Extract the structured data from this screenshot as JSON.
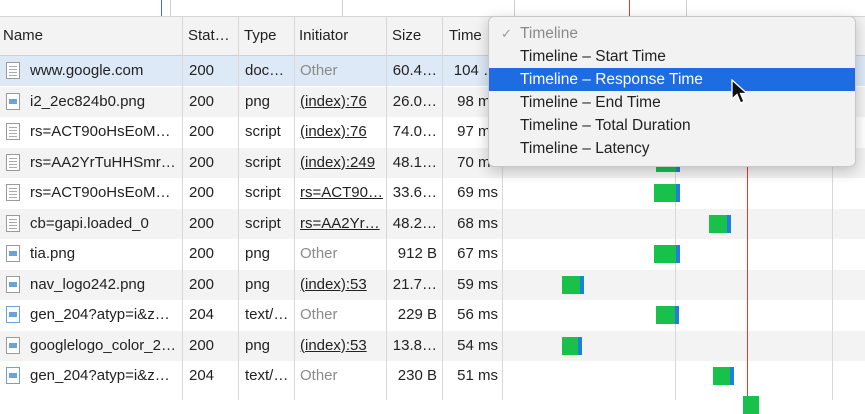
{
  "columns": {
    "name": "Name",
    "status": "Stat…",
    "type": "Type",
    "initiator": "Initiator",
    "size": "Size",
    "time": "Time"
  },
  "rows": [
    {
      "name": "www.google.com",
      "status": "200",
      "type": "doc…",
      "initiator": "Other",
      "initiator_link": false,
      "size": "60.4…",
      "time": "104 …",
      "icon": "document-icon",
      "selected": true
    },
    {
      "name": "i2_2ec824b0.png",
      "status": "200",
      "type": "png",
      "initiator": "(index):76",
      "initiator_link": true,
      "size": "26.0…",
      "time": "98 ms",
      "icon": "image-file-icon"
    },
    {
      "name": "rs=ACT90oHsEoM…",
      "status": "200",
      "type": "script",
      "initiator": "(index):76",
      "initiator_link": true,
      "size": "74.0…",
      "time": "97 ms",
      "icon": "script-file-icon"
    },
    {
      "name": "rs=AA2YrTuHHSmr…",
      "status": "200",
      "type": "script",
      "initiator": "(index):249",
      "initiator_link": true,
      "size": "48.1…",
      "time": "70 ms",
      "icon": "script-file-icon"
    },
    {
      "name": "rs=ACT90oHsEoM…",
      "status": "200",
      "type": "script",
      "initiator": "rs=ACT90…",
      "initiator_link": true,
      "size": "33.6…",
      "time": "69 ms",
      "icon": "script-file-icon"
    },
    {
      "name": "cb=gapi.loaded_0",
      "status": "200",
      "type": "script",
      "initiator": "rs=AA2Yr…",
      "initiator_link": true,
      "size": "48.2…",
      "time": "68 ms",
      "icon": "script-file-icon"
    },
    {
      "name": "tia.png",
      "status": "200",
      "type": "png",
      "initiator": "Other",
      "initiator_link": false,
      "size": "912 B",
      "time": "67 ms",
      "icon": "image-file-icon"
    },
    {
      "name": "nav_logo242.png",
      "status": "200",
      "type": "png",
      "initiator": "(index):53",
      "initiator_link": true,
      "size": "21.7…",
      "time": "59 ms",
      "icon": "image-file-icon"
    },
    {
      "name": "gen_204?atyp=i&z…",
      "status": "204",
      "type": "text/…",
      "initiator": "Other",
      "initiator_link": false,
      "size": "229 B",
      "time": "56 ms",
      "icon": "stacked-file-icon"
    },
    {
      "name": "googlelogo_color_2…",
      "status": "200",
      "type": "png",
      "initiator": "(index):53",
      "initiator_link": true,
      "size": "13.8…",
      "time": "54 ms",
      "icon": "image-file-icon"
    },
    {
      "name": "gen_204?atyp=i&z…",
      "status": "204",
      "type": "text/…",
      "initiator": "Other",
      "initiator_link": false,
      "size": "230 B",
      "time": "51 ms",
      "icon": "stacked-file-icon"
    }
  ],
  "menu": {
    "items": [
      {
        "label": "Timeline",
        "checked": true,
        "disabled": true
      },
      {
        "label": "Timeline – Start Time"
      },
      {
        "label": "Timeline – Response Time",
        "highlighted": true
      },
      {
        "label": "Timeline – End Time"
      },
      {
        "label": "Timeline – Total Duration"
      },
      {
        "label": "Timeline – Latency"
      }
    ],
    "check_glyph": "✓"
  },
  "colors": {
    "waiting": "#17c14a",
    "receiving": "#1e7fe0",
    "dom_content_loaded": "#3d6ee0",
    "load": "#e53b2c",
    "highlight": "#1d6ce2"
  }
}
